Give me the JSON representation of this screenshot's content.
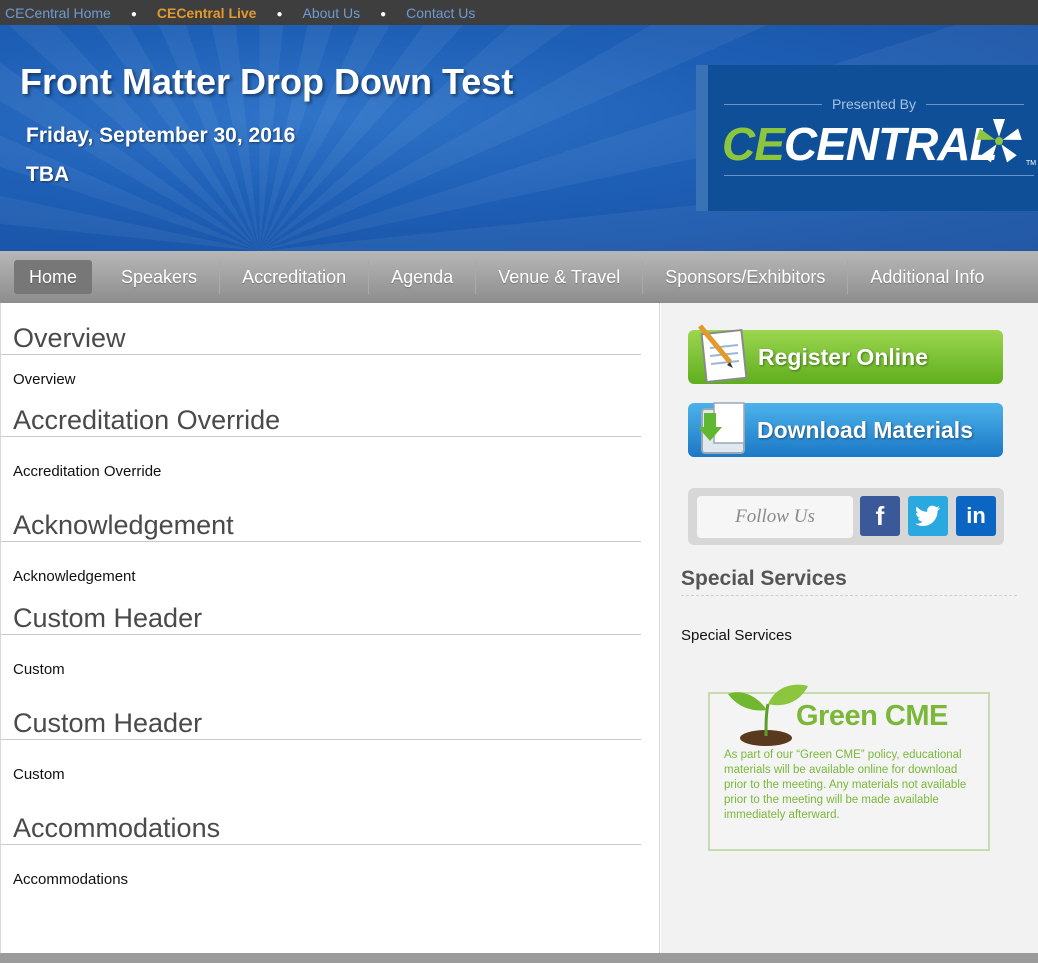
{
  "topbar": {
    "links": [
      "CECentral Home",
      "CECentral Live",
      "About Us",
      "Contact Us"
    ],
    "active_color": "#e39a2b",
    "link_color": "#6e9ad0"
  },
  "banner": {
    "title": "Front Matter Drop Down Test",
    "date": "Friday, September 30, 2016",
    "location": "TBA",
    "presented_by": "Presented By",
    "brand_prefix": "CE",
    "brand_suffix": "CENTRAL",
    "trademark": "TM"
  },
  "nav": {
    "items": [
      "Home",
      "Speakers",
      "Accreditation",
      "Agenda",
      "Venue & Travel",
      "Sponsors/Exhibitors",
      "Additional Info"
    ]
  },
  "main": {
    "sections": [
      {
        "heading": "Overview",
        "text": "Overview"
      },
      {
        "heading": "Accreditation Override",
        "text": "Accreditation Override"
      },
      {
        "heading": "Acknowledgement",
        "text": "Acknowledgement"
      },
      {
        "heading": "Custom Header",
        "text": "Custom"
      },
      {
        "heading": "Custom Header",
        "text": "Custom"
      },
      {
        "heading": "Accommodations",
        "text": "Accommodations"
      }
    ]
  },
  "sidebar": {
    "register_label": "Register Online",
    "download_label": "Download Materials",
    "follow_label": "Follow Us",
    "social": [
      "f",
      "in"
    ],
    "special_services_heading": "Special Services",
    "special_services_text": "Special Services",
    "green_cme": {
      "title": "Green CME",
      "text": "As part of our “Green CME” policy, educational materials will be available online for download prior to the meeting. Any materials not available prior to the meeting will be made available immediately afterward."
    }
  }
}
